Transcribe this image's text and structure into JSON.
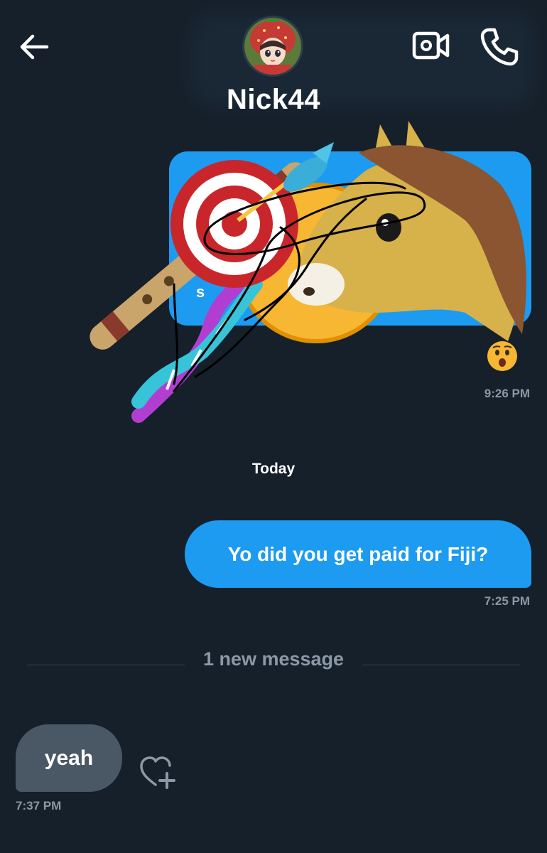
{
  "header": {
    "contact_name": "Nick44",
    "back_icon": "arrow-left-icon",
    "video_icon": "video-camera-icon",
    "call_icon": "phone-icon"
  },
  "messages": {
    "shared": {
      "snippet": "s",
      "reaction": "😲",
      "time": "9:26 PM"
    },
    "day_separator": "Today",
    "outgoing": {
      "text": "Yo did you get paid for Fiji?",
      "time": "7:25 PM"
    },
    "new_messages_label": "1 new message",
    "incoming": {
      "text": "yeah",
      "time": "7:37 PM",
      "react_icon": "heart-plus-icon"
    }
  },
  "colors": {
    "background": "#16202b",
    "accent_blue": "#1d9bf0",
    "incoming_bubble": "#4a5764",
    "muted_text": "#8b98a5"
  }
}
